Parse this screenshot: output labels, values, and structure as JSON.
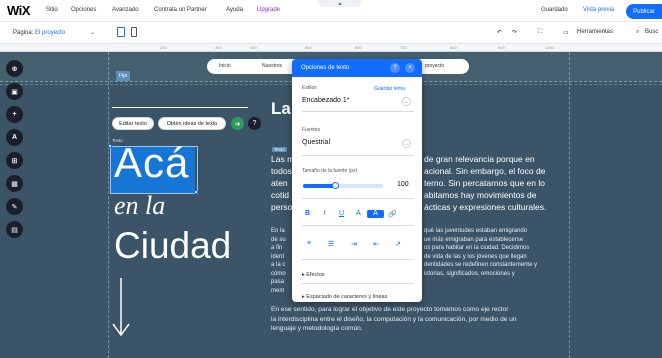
{
  "topbar": {
    "logo": "WiX",
    "menus": [
      "Sitio",
      "Opciones",
      "Avanzado",
      "Contrata un Partner",
      "Ayuda",
      "Upgrade"
    ],
    "save": "Guardado",
    "preview": "Vista previa",
    "publish": "Publicar",
    "notch": "▲"
  },
  "bar2": {
    "page_prefix": "Página:",
    "page_name": "El proyecto",
    "tools": "Herramientas",
    "search": "Busc"
  },
  "ruler": [
    "200",
    "300",
    "400",
    "500",
    "600",
    "700",
    "800",
    "900",
    "1000"
  ],
  "canvas": {
    "fixed_tag": "Fija",
    "nav_items": [
      "Inicio",
      "Nuestros",
      "proyecto"
    ],
    "title_words": [
      "Acá",
      "en la",
      "Ciudad"
    ],
    "text_tag": "Texto",
    "text_tag_right": "Texto",
    "edit_text": "Editar texto",
    "ideas_text": "Obtén ideas de texto",
    "heading": "La",
    "para1_lines": [
      "Las m",
      "todos",
      "aten",
      "cotid",
      "perso"
    ],
    "para1_right_lines": [
      "de gran relevancia porque en",
      "acional. Sin embargo, el foco de",
      "terno. Sin percatarnos que en lo",
      "abitamos hay movimientos de",
      "ácticas y expresiones culturales."
    ],
    "para2_left_lines": [
      "En la",
      "de su",
      "a fin",
      "ident",
      "a la c",
      "cómo",
      "pasa",
      "mem"
    ],
    "para2_right_lines": [
      "qué las juventudes estaban emigrando",
      "ue más emigraban para establecerse",
      "os para habitar en la ciudad. Decidimos",
      "de vida de las y los jóvenes que llegan",
      "dentidades se redefinen constantemente y",
      "istorias, significados, emociones y",
      "",
      ""
    ],
    "para3_lines": [
      "En ese sentido, para lograr el objetivo de este proyecto tomamos como eje rector",
      "la interdisciplina entre el diseño, la computación y la comunicación, por medio de un",
      "lenguaje y metodología común."
    ]
  },
  "panel": {
    "title": "Opciones de texto",
    "help": "?",
    "close": "×",
    "styles_label": "Estilos",
    "save_theme": "Guardar tema",
    "style_value": "Encabezado 1*",
    "font_label": "Fuentes",
    "font_value": "Questrial",
    "size_label": "Tamaño de la fuente (px)",
    "size_value": "100",
    "size_fraction": 0.4,
    "format_buttons": [
      "B",
      "I",
      "U",
      "A",
      "A",
      "🔗"
    ],
    "align_buttons": [
      "≡",
      "☰",
      "⇥",
      "⇤",
      "↗"
    ],
    "effects": "Efectos",
    "spacing": "Espaciado de caracteres y líneas"
  },
  "colors": {
    "accent": "#116dff",
    "canvas_bg": "#3b5467",
    "selection": "#1676d6"
  },
  "icons": {
    "sidebar": [
      "add-icon",
      "layers-icon",
      "plus-circle-icon",
      "font-icon",
      "apps-icon",
      "media-icon",
      "pen-icon",
      "bag-icon"
    ],
    "sidebar_glyphs": [
      "⊕",
      "▣",
      "+",
      "A",
      "⊞",
      "▦",
      "✎",
      "▤"
    ]
  }
}
